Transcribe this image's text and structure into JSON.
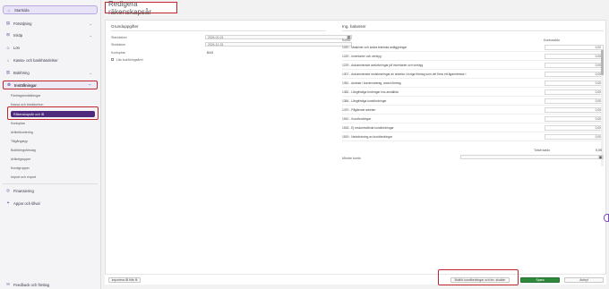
{
  "sidebar": {
    "start": "Startsida",
    "items": [
      {
        "label": "Försäljning"
      },
      {
        "label": "Inköp"
      },
      {
        "label": "Lön"
      },
      {
        "label": "Kassa- och bankhändelser"
      },
      {
        "label": "Bokföring"
      },
      {
        "label": "Inställningar"
      }
    ],
    "sub_items": [
      "Företagsinställningar",
      "Kassa och bankkonton",
      "Räkenskapsår och IB",
      "Kontoplan",
      "Artikelkontering",
      "Tillgångstyp",
      "Bokföringsförslag",
      "Artikelgrupper",
      "Kundgrupper",
      "Import och export"
    ],
    "bottom": [
      {
        "label": "Finansiering"
      },
      {
        "label": "Appar och tillval"
      }
    ],
    "feedback": "Feedback och förslag"
  },
  "page": {
    "title": "Redigera räkenskapsår"
  },
  "basics": {
    "title": "Grunduppgifter",
    "start_label": "Startdatum",
    "start_value": "2024-01-01",
    "end_label": "Slutdatum",
    "end_value": "2024-12-31",
    "chart_label": "Kontoplan",
    "chart_value": "BAS",
    "lock_label": "Lås bokföringsåret"
  },
  "balances": {
    "title": "Ing. balanser",
    "col_account": "Konto",
    "col_balance": "Kontosaldo",
    "rows": [
      {
        "label": "1210 - Maskiner och andra tekniska anläggningar",
        "value": "0,00"
      },
      {
        "label": "1220 - Inventarier och verktyg",
        "value": "0,00"
      },
      {
        "label": "1229 - Ackumulerade avskrivningar på inventarier och verktyg",
        "value": "0,00"
      },
      {
        "label": "1307 - Ackumulerade nedskrivningar av andelar i övriga företag som det finns ett ägarintresse i",
        "value": "0,00"
      },
      {
        "label": "1351 - Andelar i kundenoterag, andra företag",
        "value": "0,00"
      },
      {
        "label": "1382 - Långfristiga fordringar hos anställda",
        "value": "0,00"
      },
      {
        "label": "1384 - Långfristiga kundfordringar",
        "value": "0,00"
      },
      {
        "label": "1470 - Pågående arbeten",
        "value": "0,00"
      },
      {
        "label": "1510 - Kundfordringar",
        "value": "0,00"
      },
      {
        "label": "1518 - Ej reskontraförda kundfordringar",
        "value": "0,00"
      },
      {
        "label": "1519 - Nedskrivning av kundfordringar",
        "value": "0,00"
      }
    ],
    "total_label": "Totalt saldo",
    "total_value": "0,00",
    "less_label": "Mindre konto"
  },
  "footer": {
    "import_label": "Importera IB från fil",
    "update_label": "Bokför kundfordringar och lev. skulder",
    "save_label": "Spara",
    "cancel_label": "Avbryt"
  }
}
